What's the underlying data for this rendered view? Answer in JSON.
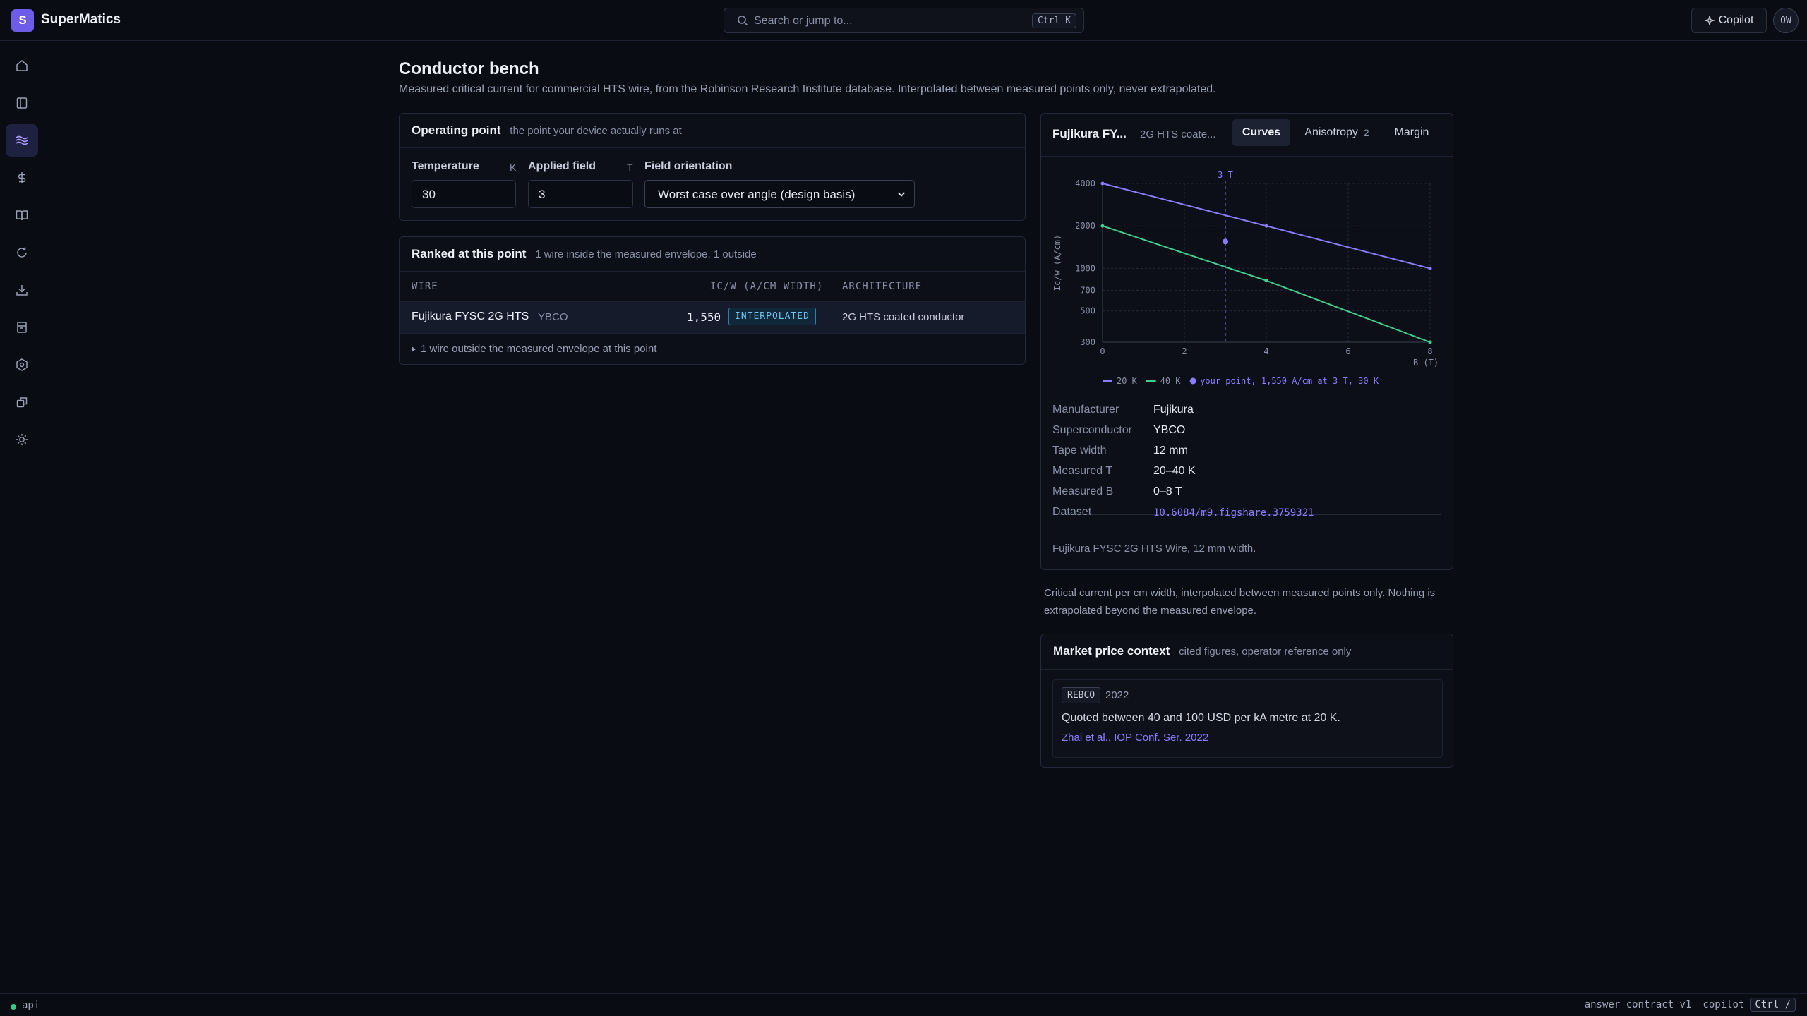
{
  "app": {
    "logo_letter": "S",
    "name": "SuperMatics",
    "avatar_initials": "OW"
  },
  "search": {
    "placeholder": "Search or jump to...",
    "shortcut": "Ctrl K"
  },
  "copilot": {
    "label": "Copilot"
  },
  "sidebar": {
    "items": [
      {
        "icon": "home-icon"
      },
      {
        "icon": "sidebar-panel-icon"
      },
      {
        "icon": "waves-icon",
        "active": true
      },
      {
        "icon": "dollar-icon"
      },
      {
        "icon": "book-icon"
      },
      {
        "icon": "refresh-icon"
      },
      {
        "icon": "download-icon"
      },
      {
        "icon": "archive-icon"
      },
      {
        "icon": "hexagon-icon"
      },
      {
        "icon": "export-icon"
      },
      {
        "icon": "sun-icon"
      }
    ]
  },
  "page": {
    "title": "Conductor bench",
    "subtitle": "Measured critical current for commercial HTS wire, from the Robinson Research Institute database. Interpolated between measured points only, never extrapolated."
  },
  "operating_point": {
    "title": "Operating point",
    "note": "the point your device actually runs at",
    "temperature": {
      "label": "Temperature",
      "unit": "K",
      "value": "30"
    },
    "applied_field": {
      "label": "Applied field",
      "unit": "T",
      "value": "3"
    },
    "field_orientation": {
      "label": "Field orientation",
      "value": "Worst case over angle (design basis)"
    }
  },
  "ranked": {
    "title": "Ranked at this point",
    "note": "1 wire inside the measured envelope, 1 outside",
    "columns": {
      "wire": "WIRE",
      "icw": "IC/W (A/CM WIDTH)",
      "architecture": "ARCHITECTURE"
    },
    "rows": [
      {
        "wire": "Fujikura FYSC 2G HTS",
        "material": "YBCO",
        "icw": "1,550",
        "badge": "INTERPOLATED",
        "architecture": "2G HTS coated conductor"
      }
    ],
    "outside_toggle": "1 wire outside the measured envelope at this point"
  },
  "detail": {
    "title": "Fujikura FY...",
    "subtitle": "2G HTS coate...",
    "tabs": [
      {
        "label": "Curves",
        "active": true
      },
      {
        "label": "Anisotropy",
        "count": "2"
      },
      {
        "label": "Margin"
      }
    ],
    "properties": [
      {
        "key": "Manufacturer",
        "value": "Fujikura"
      },
      {
        "key": "Superconductor",
        "value": "YBCO"
      },
      {
        "key": "Tape width",
        "value": "12 mm"
      },
      {
        "key": "Measured T",
        "value": "20–40 K"
      },
      {
        "key": "Measured B",
        "value": "0–8 T"
      },
      {
        "key": "Dataset",
        "value": "10.6084/m9.figshare.3759321"
      }
    ],
    "footnote": "Fujikura FYSC 2G HTS Wire, 12 mm width."
  },
  "chart_caption": "Critical current per cm width, interpolated between measured points only. Nothing is extrapolated beyond the measured envelope.",
  "chart_data": {
    "type": "line",
    "ylabel": "Ic/w (A/cm)",
    "xlabel": "B (T)",
    "x_ticks": [
      "0",
      "2",
      "4",
      "6",
      "8"
    ],
    "y_ticks": [
      "4000",
      "2000",
      "1000",
      "700",
      "500",
      "300"
    ],
    "y_scale": "log",
    "xlim": [
      0,
      8
    ],
    "ylim": [
      300,
      4000
    ],
    "grid": true,
    "legend_position": "bottom",
    "marker_label": "3 T",
    "marker_x": 3,
    "series": [
      {
        "name": "20 K",
        "color": "#8b7dff",
        "x": [
          0,
          4,
          8
        ],
        "y": [
          4000,
          2000,
          1000
        ]
      },
      {
        "name": "40 K",
        "color": "#3fcf8e",
        "x": [
          0,
          4,
          8
        ],
        "y": [
          2000,
          820,
          300
        ]
      }
    ],
    "point": {
      "label": "your point, 1,550 A/cm at 3 T, 30 K",
      "x": 3,
      "y": 1550,
      "color": "#8b7dff"
    }
  },
  "market": {
    "title": "Market price context",
    "note": "cited figures, operator reference only",
    "entry": {
      "tag": "REBCO",
      "year": "2022",
      "text": "Quoted between 40 and 100 USD per kA metre at 20 K.",
      "citation": "Zhai et al., IOP Conf. Ser. 2022"
    }
  },
  "status": {
    "left": "api",
    "contract": "answer contract v1",
    "copilot_label": "copilot",
    "copilot_shortcut": "Ctrl /"
  }
}
